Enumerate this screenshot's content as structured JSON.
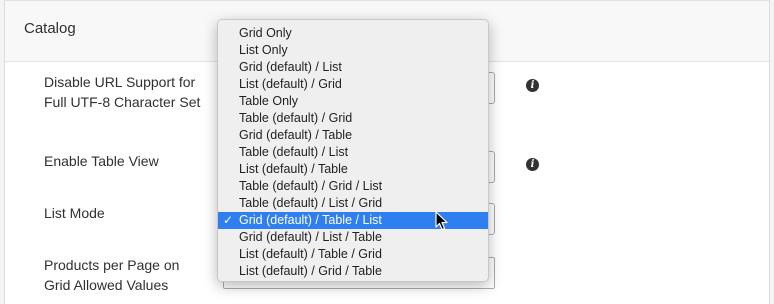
{
  "section": {
    "title": "Catalog"
  },
  "fields": [
    {
      "label": "Disable URL Support for Full UTF-8 Character Set"
    },
    {
      "label": "Enable Table View"
    },
    {
      "label": "List Mode"
    },
    {
      "label": "Products per Page on Grid Allowed Values"
    }
  ],
  "dropdown": {
    "selected_index": 11,
    "options": [
      "Grid Only",
      "List Only",
      "Grid (default) / List",
      "List (default) / Grid",
      "Table Only",
      "Table (default) / Grid",
      "Grid (default) / Table",
      "Table (default) / List",
      "List (default) / Table",
      "Table (default) / Grid / List",
      "Table (default) / List / Grid",
      "Grid (default) / Table / List",
      "Grid (default) / List / Table",
      "List (default) / Table / Grid",
      "List (default) / Grid / Table"
    ],
    "check_glyph": "✓"
  },
  "icons": {
    "info_glyph": "i",
    "info_icon": "info-icon",
    "select_arrows": "select-arrows-icon",
    "cursor": "mouse-pointer-icon",
    "check": "check-icon"
  },
  "colors": {
    "selected_bg": "#2f7ff0",
    "menu_bg": "#efefef",
    "info_icon": "#333333"
  }
}
